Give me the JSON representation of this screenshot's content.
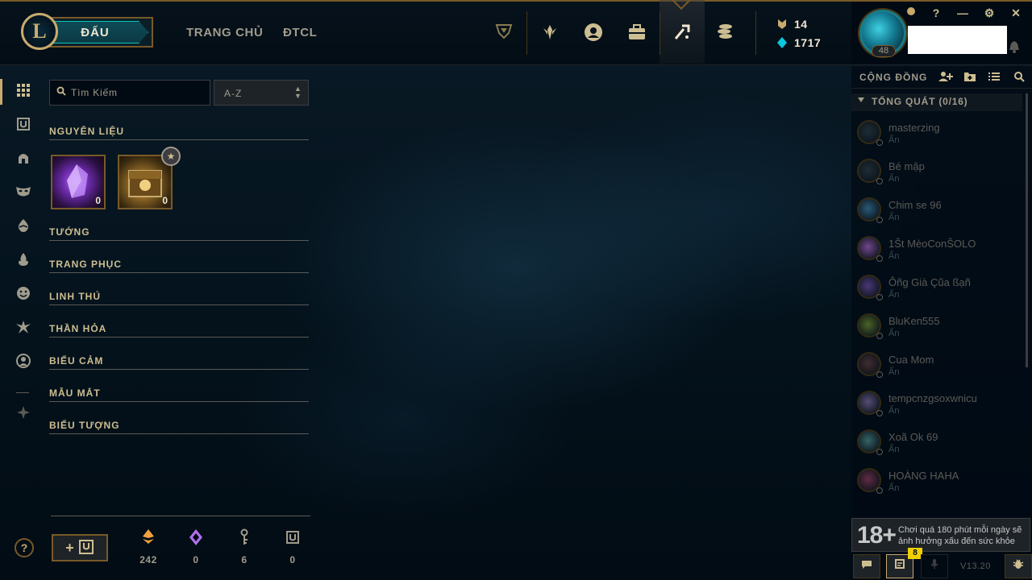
{
  "nav": {
    "play_label": "ĐẤU",
    "logo_letter": "L",
    "links": [
      "TRANG CHỦ",
      "ĐTCL"
    ],
    "icons": [
      "clash-trophy-icon",
      "ranked-icon",
      "profile-icon",
      "collection-icon",
      "loot-icon",
      "store-icon"
    ],
    "active_icon": "loot-icon"
  },
  "currency": {
    "blue_essence": "14",
    "riot_points": "1717"
  },
  "profile": {
    "level": "48",
    "status_color": "#c8aa6e"
  },
  "window": {
    "help": "?",
    "minimize": "—",
    "settings": "⚙",
    "close": "✕"
  },
  "search": {
    "placeholder": "Tìm Kiếm"
  },
  "sort": {
    "value": "A-Z"
  },
  "categories": [
    "NGUYÊN LIỆU",
    "TƯỚNG",
    "TRANG PHỤC",
    "LINH THÚ",
    "THẦN HỎA",
    "BIỂU CẢM",
    "MẪU MẮT",
    "BIỂU TƯỢNG"
  ],
  "materials": [
    {
      "name": "orb-of-hextech-loot",
      "qty": "0"
    },
    {
      "name": "hextech-chest-loot",
      "qty": "0"
    }
  ],
  "footer": {
    "craft_label": "+",
    "stats": [
      {
        "icon": "orange-essence-icon",
        "value": "242",
        "color": "#f0a040"
      },
      {
        "icon": "mythic-essence-icon",
        "value": "0",
        "color": "#b070f0"
      },
      {
        "icon": "key-icon",
        "value": "6",
        "color": "#a09b8c"
      },
      {
        "icon": "chest-icon",
        "value": "0",
        "color": "#a09b8c"
      }
    ]
  },
  "social": {
    "title": "CỘNG ĐỒNG",
    "group_label": "TỔNG QUÁT (0/16)",
    "friends": [
      {
        "name": "masterzing",
        "status": "Ẩn"
      },
      {
        "name": "Bé mập",
        "status": "Ẩn"
      },
      {
        "name": "Chim se 96",
        "status": "Ẩn"
      },
      {
        "name": "1Ŝt MèoConŜOLO",
        "status": "Ẩn"
      },
      {
        "name": "Ôñg Già Çũa ßạñ",
        "status": "Ẩn"
      },
      {
        "name": "BluKen555",
        "status": "Ẩn"
      },
      {
        "name": "Cua Mom",
        "status": "Ẩn"
      },
      {
        "name": "tempcnzgsoxwnicu",
        "status": "Ẩn"
      },
      {
        "name": "Xoã Ok 69",
        "status": "Ẩn"
      },
      {
        "name": "HOÀNG HAHA",
        "status": "Ẩn"
      }
    ]
  },
  "warning": {
    "age": "18+",
    "text": "Chơi quá 180 phút mỗi ngày sẽ ảnh hưởng xấu đến sức khỏe"
  },
  "bottom": {
    "notification_count": "8",
    "version": "V13.20"
  }
}
